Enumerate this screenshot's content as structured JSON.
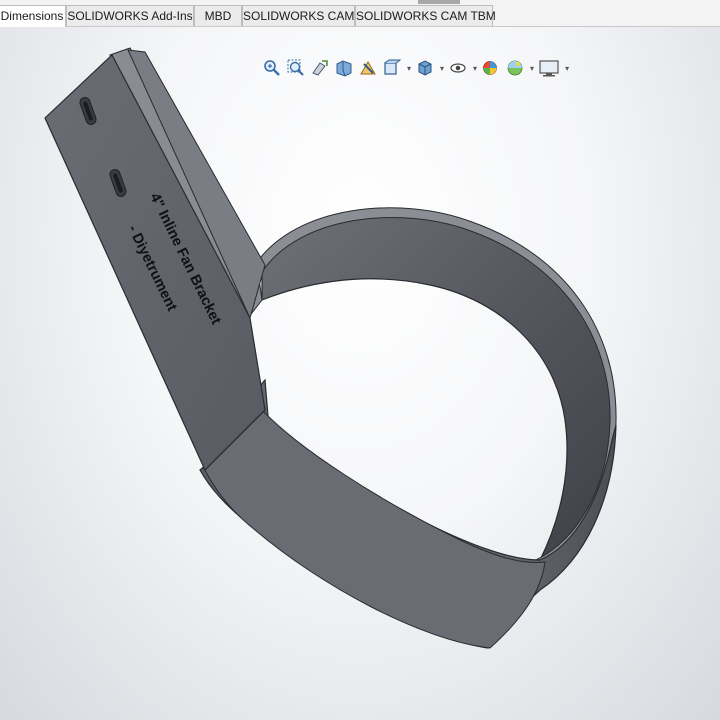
{
  "tabs": [
    {
      "label": "Dimensions",
      "active": true
    },
    {
      "label": "SOLIDWORKS Add-Ins",
      "active": false
    },
    {
      "label": "MBD",
      "active": false
    },
    {
      "label": "SOLIDWORKS CAM",
      "active": false
    },
    {
      "label": "SOLIDWORKS CAM TBM",
      "active": false
    }
  ],
  "heads_up_toolbar": [
    {
      "icon": "zoom-to-fit-icon"
    },
    {
      "icon": "zoom-to-area-icon"
    },
    {
      "icon": "previous-view-icon"
    },
    {
      "icon": "section-view-icon"
    },
    {
      "icon": "dynamic-annotation-views-icon"
    },
    {
      "icon": "view-orientation-icon"
    },
    {
      "icon": "display-style-icon"
    },
    {
      "icon": "hide-show-items-icon"
    },
    {
      "icon": "edit-appearance-icon"
    },
    {
      "icon": "apply-scene-icon"
    },
    {
      "icon": "view-settings-icon"
    }
  ],
  "model": {
    "engraved_text_line1": "4\" Inline Fan Bracket",
    "engraved_text_line2": "- Diyetrument",
    "body_color": "#5f6168",
    "edge_color": "#2a2b30"
  },
  "colors": {
    "tab_bar_bg": "#f3f3f3",
    "viewport_gradient_center": "#ffffff",
    "viewport_gradient_edge": "#d6d9de"
  }
}
